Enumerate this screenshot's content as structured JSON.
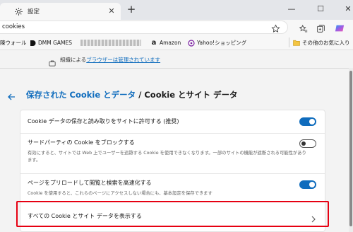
{
  "tab": {
    "title": "設定",
    "icon": "gear-icon"
  },
  "window_controls": [
    "minimize",
    "maximize",
    "close"
  ],
  "address_bar": {
    "url": "cookies"
  },
  "favorites": [
    {
      "label": "陳ウォール",
      "icon": "none"
    },
    {
      "label": "DMM GAMES",
      "icon": "dmm-logo-icon"
    },
    {
      "label": "",
      "icon": "blurred-item-icon"
    },
    {
      "label": "Amazon",
      "icon": "amazon-logo-icon"
    },
    {
      "label": "Yahoo!ショッピング",
      "icon": "yahoo-logo-icon"
    },
    {
      "label": "その他のお気に入り",
      "icon": "folder-icon"
    }
  ],
  "managed_notice": {
    "prefix": "組織による",
    "link": "ブラウザーは管理されています"
  },
  "heading": {
    "parent": "保存された Cookie とデータ",
    "separator": " / ",
    "current": "Cookie とサイト データ"
  },
  "settings": [
    {
      "title": "Cookie データの保存と読み取りをサイトに許可する (推奨)",
      "description": "",
      "toggle": "on"
    },
    {
      "title": "サードパーティの Cookie をブロックする",
      "description": "有効にすると、サイトでは Web 上でユーザーを追跡する Cookie を使用できなくなります。一部のサイトの機能が遮断される可能性があります。",
      "toggle": "off"
    },
    {
      "title": "ページをプリロードして閲覧と検索を高速化する",
      "description": "Cookie を使用すると、これらのページにアクセスしない場合にも、基本設定を保存できます",
      "toggle": "on"
    },
    {
      "title": "すべての Cookie とサイト データを表示する",
      "description": "",
      "toggle": "chevron"
    }
  ],
  "colors": {
    "accent": "#0f6cbd",
    "highlight": "#e60012"
  }
}
